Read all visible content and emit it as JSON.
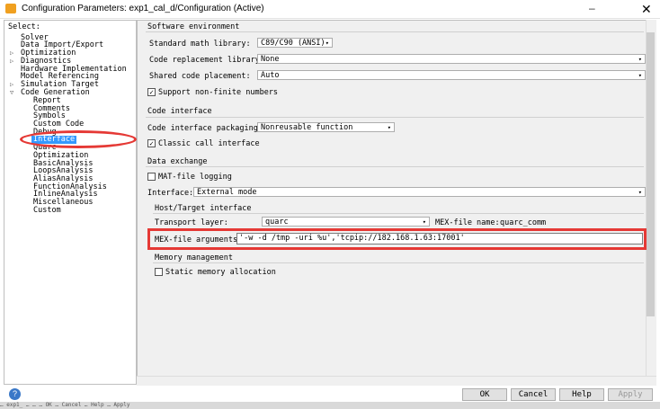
{
  "window": {
    "title": "Configuration Parameters: exp1_cal_d/Configuration (Active)",
    "minimize_glyph": "–",
    "close_glyph": "✕"
  },
  "tree": {
    "header": "Select:",
    "items": [
      "Solver",
      "Data Import/Export",
      "Optimization",
      "Diagnostics",
      "Hardware Implementation",
      "Model Referencing",
      "Simulation Target",
      "Code Generation"
    ],
    "children": [
      "Report",
      "Comments",
      "Symbols",
      "Custom Code",
      "Debug",
      "Interface",
      "Quarc",
      "Optimization",
      "BasicAnalysis",
      "LoopsAnalysis",
      "AliasAnalysis",
      "FunctionAnalysis",
      "InlineAnalysis",
      "Miscellaneous",
      "Custom"
    ],
    "selected": "Interface"
  },
  "software": {
    "title": "Software environment",
    "math_label": "Standard math library:",
    "math_value": "C89/C90 (ANSI)",
    "replacement_label": "Code replacement library:",
    "replacement_value": "None",
    "placement_label": "Shared code placement:",
    "placement_value": "Auto",
    "nonfinite_label": "Support non-finite numbers"
  },
  "code_interface": {
    "title": "Code interface",
    "packaging_label": "Code interface packaging:",
    "packaging_value": "Nonreusable function",
    "classic_label": "Classic call interface"
  },
  "data_exchange": {
    "title": "Data exchange",
    "matfile_label": "MAT-file logging",
    "interface_label": "Interface:",
    "interface_value": "External mode"
  },
  "host_target": {
    "title": "Host/Target interface",
    "transport_label": "Transport layer:",
    "transport_value": "quarc",
    "mex_name_label": "MEX-file name:",
    "mex_name_value": "quarc_comm",
    "mex_args_label": "MEX-file arguments:",
    "mex_args_value": "'-w -d /tmp -uri %u','tcpip://182.168.1.63:17001'"
  },
  "memory": {
    "title": "Memory management",
    "static_label": "Static memory allocation"
  },
  "buttons": {
    "ok": "OK",
    "cancel": "Cancel",
    "help": "Help",
    "apply": "Apply"
  },
  "taskbar": {
    "text": "… exp1_ … … … OK … Cancel … Help … Apply"
  }
}
